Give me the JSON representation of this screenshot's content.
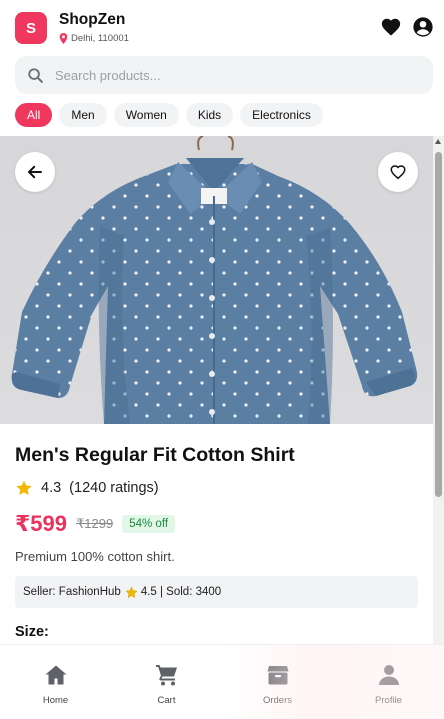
{
  "header": {
    "logo_letter": "S",
    "brand": "ShopZen",
    "location": "Delhi, 110001",
    "icons": [
      "location-pin-icon",
      "heart-icon",
      "account-icon"
    ]
  },
  "search": {
    "placeholder": "Search products..."
  },
  "categories": [
    {
      "label": "All",
      "active": true
    },
    {
      "label": "Men",
      "active": false
    },
    {
      "label": "Women",
      "active": false
    },
    {
      "label": "Kids",
      "active": false
    },
    {
      "label": "Electronics",
      "active": false
    }
  ],
  "product": {
    "title": "Men's Regular Fit Cotton Shirt",
    "rating": "4.3",
    "ratings_count": "(1240 ratings)",
    "price": "₹599",
    "mrp": "₹1299",
    "discount": "54% off",
    "description": "Premium 100% cotton shirt.",
    "seller_prefix": "Seller: FashionHub",
    "seller_rating_and_sold": "4.5 | Sold: 3400",
    "size_label": "Size:"
  },
  "bottom_nav": [
    {
      "label": "Home",
      "icon": "home-icon"
    },
    {
      "label": "Cart",
      "icon": "cart-icon"
    },
    {
      "label": "Orders",
      "icon": "orders-icon"
    },
    {
      "label": "Profile",
      "icon": "profile-icon"
    }
  ],
  "colors": {
    "accent": "#f0385f",
    "price": "#e8335e",
    "discount_text": "#1a8a3c",
    "discount_bg": "#e3f7e8",
    "star": "#f5b800",
    "chip_bg": "#f2f3f5"
  }
}
